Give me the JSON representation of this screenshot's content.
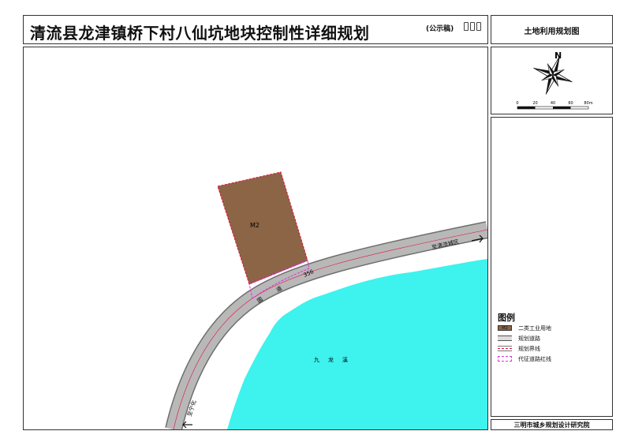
{
  "title": "清流县龙津镇桥下村八仙坑地块控制性详细规划",
  "draft_label": "(公示稿)",
  "side_title": "土地利用规划图",
  "north_label": "N",
  "scale_ticks": [
    "0",
    "20",
    "40",
    "60",
    "80m"
  ],
  "map": {
    "plot_code": "M2",
    "road_number": "356",
    "road_name_chars": [
      "国",
      "道"
    ],
    "to_city_label": "至清流城区",
    "to_ninghua_label": "至宁化",
    "river_name_chars": [
      "九",
      "龙",
      "溪"
    ],
    "colors": {
      "plot_fill": "#8b6545",
      "plot_boundary": "#e0103a",
      "road_fill": "#b8b8b8",
      "road_edge": "#6f6f6f",
      "redline": "#dd33dd",
      "river_fill": "#3ef2ee"
    }
  },
  "legend": {
    "title": "图例",
    "items": [
      {
        "code": "M2",
        "label": "二类工业用地"
      },
      {
        "code": "",
        "label": "规划道路"
      },
      {
        "code": "",
        "label": "规划界线"
      },
      {
        "code": "",
        "label": "代征道路红线"
      }
    ]
  },
  "institute": "三明市城乡规划设计研究院"
}
